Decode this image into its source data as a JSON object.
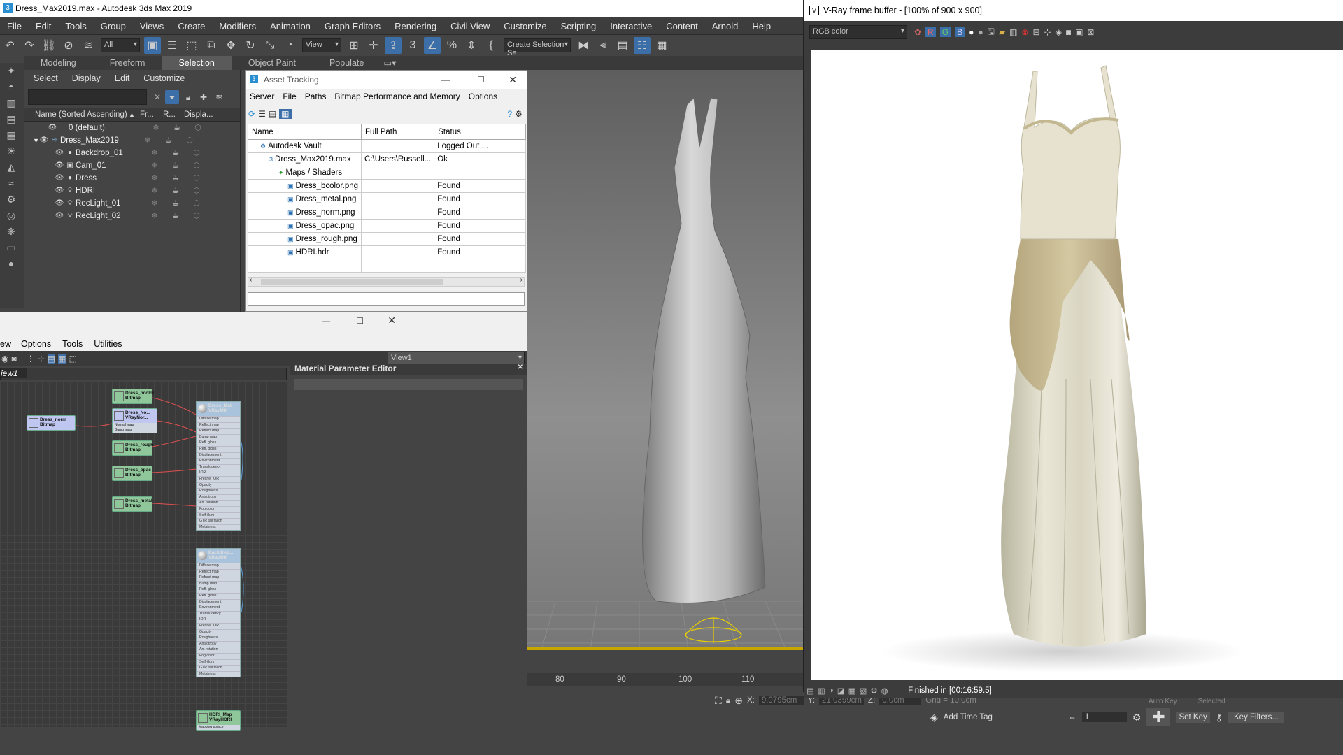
{
  "app": {
    "title": "Dress_Max2019.max - Autodesk 3ds Max 2019"
  },
  "menu": [
    "File",
    "Edit",
    "Tools",
    "Group",
    "Views",
    "Create",
    "Modifiers",
    "Animation",
    "Graph Editors",
    "Rendering",
    "Civil View",
    "Customize",
    "Scripting",
    "Interactive",
    "Content",
    "Arnold",
    "Help"
  ],
  "toolbar": {
    "filter_value": "All",
    "view_value": "View",
    "selection_set_placeholder": "Create Selection Se"
  },
  "ribbon": {
    "tabs": [
      "Modeling",
      "Freeform",
      "Selection",
      "Object Paint",
      "Populate"
    ],
    "active": "Selection"
  },
  "scene_explorer": {
    "menu": [
      "Select",
      "Display",
      "Edit",
      "Customize"
    ],
    "columns": {
      "name": "Name (Sorted Ascending)",
      "fr": "Fr...",
      "r": "R...",
      "display": "Displa..."
    },
    "rows": [
      {
        "label": "0 (default)",
        "level": 1,
        "type": "layer"
      },
      {
        "label": "Dress_Max2019",
        "level": 1,
        "type": "layer"
      },
      {
        "label": "Backdrop_01",
        "level": 2,
        "type": "geo"
      },
      {
        "label": "Cam_01",
        "level": 2,
        "type": "camera"
      },
      {
        "label": "Dress",
        "level": 2,
        "type": "geo"
      },
      {
        "label": "HDRI",
        "level": 2,
        "type": "light"
      },
      {
        "label": "RecLight_01",
        "level": 2,
        "type": "light"
      },
      {
        "label": "RecLight_02",
        "level": 2,
        "type": "light"
      }
    ]
  },
  "asset_tracking": {
    "title": "Asset Tracking",
    "menu": [
      "Server",
      "File",
      "Paths",
      "Bitmap Performance and Memory",
      "Options"
    ],
    "columns": [
      "Name",
      "Full Path",
      "Status"
    ],
    "rows": [
      {
        "name": "Autodesk Vault",
        "path": "",
        "status": "Logged Out ...",
        "indent": 1
      },
      {
        "name": "Dress_Max2019.max",
        "path": "C:\\Users\\Russell...",
        "status": "Ok",
        "indent": 2
      },
      {
        "name": "Maps / Shaders",
        "path": "",
        "status": "",
        "indent": 3
      },
      {
        "name": "Dress_bcolor.png",
        "path": "",
        "status": "Found",
        "indent": 4
      },
      {
        "name": "Dress_metal.png",
        "path": "",
        "status": "Found",
        "indent": 4
      },
      {
        "name": "Dress_norm.png",
        "path": "",
        "status": "Found",
        "indent": 4
      },
      {
        "name": "Dress_opac.png",
        "path": "",
        "status": "Found",
        "indent": 4
      },
      {
        "name": "Dress_rough.png",
        "path": "",
        "status": "Found",
        "indent": 4
      },
      {
        "name": "HDRI.hdr",
        "path": "",
        "status": "Found",
        "indent": 4
      },
      {
        "name": "",
        "path": "",
        "status": "",
        "indent": 0
      }
    ]
  },
  "slate": {
    "menu": [
      "ew",
      "Options",
      "Tools",
      "Utilities"
    ],
    "view_dropdown": "View1",
    "view_tab": "iew1",
    "param_editor_title": "Material Parameter Editor",
    "nodes": [
      {
        "id": "bcolor",
        "line1": "Dress_bcolor",
        "line2": "Bitmap",
        "color": "#8fc79a"
      },
      {
        "id": "nrm",
        "line1": "Dress_No...",
        "line2": "VRayNor...",
        "color": "#bfc6f0",
        "slots": [
          "Normal map",
          "Bump map"
        ]
      },
      {
        "id": "norm",
        "line1": "Dress_norm",
        "line2": "Bitmap",
        "color": "#bfc6f0"
      },
      {
        "id": "rough",
        "line1": "Dress_rough",
        "line2": "Bitmap",
        "color": "#8fc79a"
      },
      {
        "id": "opac",
        "line1": "Dress_opac",
        "line2": "Bitmap",
        "color": "#8fc79a"
      },
      {
        "id": "metal",
        "line1": "Dress_metal",
        "line2": "Bitmap",
        "color": "#8fc79a"
      },
      {
        "id": "hdri",
        "line1": "HDRI_Map",
        "line2": "VRayHDRI",
        "color": "#8fc79a",
        "slots": [
          "Mapping source"
        ]
      }
    ],
    "materials": [
      {
        "line1": "Dress_Mat",
        "line2": "VRayMtl"
      },
      {
        "line1": "Backdrop...",
        "line2": "VRayMtl"
      }
    ],
    "mat_slots": [
      "Diffuse map",
      "Reflect map",
      "Refract map",
      "Bump map",
      "Refl. gloss",
      "Refr. gloss",
      "Displacement",
      "Environment",
      "Translucency",
      "IOR",
      "Fresnel IOR",
      "Opacity",
      "Roughness",
      "Anisotropy",
      "An. rotation",
      "Fog color",
      "Self-illum",
      "GTR tail falloff",
      "Metalness"
    ]
  },
  "timeline": {
    "ticks": [
      "80",
      "90",
      "100",
      "110"
    ]
  },
  "status": {
    "x_label": "X:",
    "x_value": "9.0795cm",
    "y_label": "Y:",
    "y_value": "21.0399cm",
    "z_label": "Z:",
    "z_value": "0.0cm",
    "grid": "Grid = 10.0cm",
    "add_time_tag": "Add Time Tag",
    "auto_key": "Auto Key",
    "selected": "Selected",
    "set_key": "Set Key",
    "key_filters": "Key Filters...",
    "frame": "1"
  },
  "vfb": {
    "title": "V-Ray frame buffer - [100% of 900 x 900]",
    "channel": "RGB color",
    "status": "Finished in [00:16:59.5]"
  },
  "colors": {
    "accent": "#3c6ea8",
    "ui_bg": "#444444",
    "node_green": "#8fc79a",
    "node_blue": "#bfc6f0",
    "material": "#a9c3dc"
  }
}
